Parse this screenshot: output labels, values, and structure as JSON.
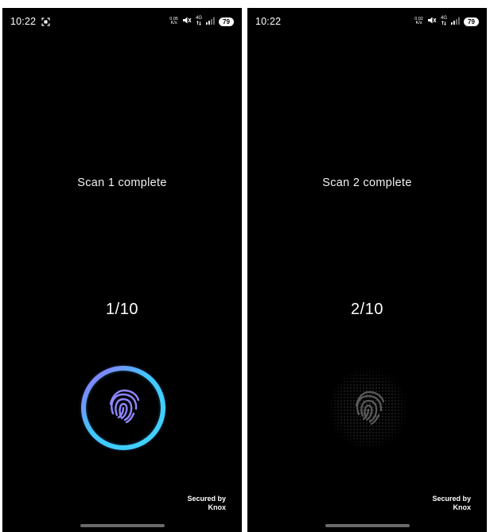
{
  "screens": [
    {
      "status": {
        "time": "10:22",
        "net_speed_value": "0.05",
        "net_speed_unit": "K/s",
        "network": "4G",
        "battery": "79"
      },
      "scan_title": "Scan 1 complete",
      "scan_progress": "1/10",
      "progress_fraction": 0.1,
      "sensor_state": "active",
      "knox_line1": "Secured by",
      "knox_line2": "Knox"
    },
    {
      "status": {
        "time": "10:22",
        "net_speed_value": "0.02",
        "net_speed_unit": "K/s",
        "network": "4G",
        "battery": "79"
      },
      "scan_title": "Scan 2 complete",
      "scan_progress": "2/10",
      "progress_fraction": 0.2,
      "sensor_state": "dimmed",
      "knox_line1": "Secured by",
      "knox_line2": "Knox"
    }
  ],
  "icons": {
    "screenshot": "screenshot-icon",
    "mute": "mute-icon",
    "data_arrows": "data-arrows-icon",
    "signal": "signal-icon",
    "fingerprint": "fingerprint-icon"
  },
  "colors": {
    "background": "#000000",
    "ring_cyan": "#3fd2ff",
    "ring_violet": "#8a6bff",
    "fingerprint_active": "#8f86ff",
    "fingerprint_dimmed": "#5a5a5a"
  }
}
